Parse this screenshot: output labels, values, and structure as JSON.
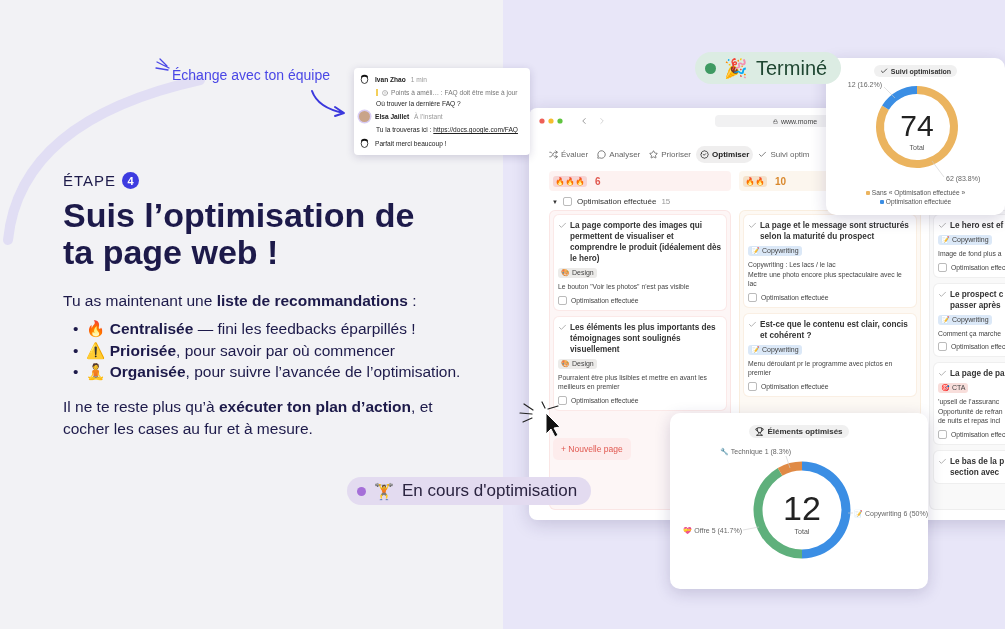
{
  "annotation": {
    "text": "Échange avec ton équipe"
  },
  "chat": {
    "messages": [
      {
        "kind": "sketch",
        "author": "Ivan Zhao",
        "time": "1 min",
        "quote": "Points à améli…  : FAQ doit être mise à jour",
        "text": "Où trouver la dernière FAQ ?"
      },
      {
        "kind": "photo",
        "author": "Elsa Jaillet",
        "time": "À l’instant",
        "text": "Tu la trouveras ici : ",
        "link": "https://docs.google.com/FAQ"
      },
      {
        "kind": "sketch",
        "text": "Parfait merci beaucoup !"
      }
    ]
  },
  "step": {
    "label": "ÉTAPE",
    "number": "4"
  },
  "heading": "**Suis l’optimisation** de ta page web !",
  "intro": "Tu as maintenant une **liste de recommandations** :",
  "bullets": [
    {
      "marker": "•",
      "emoji": "🔥",
      "text": "**Centralisée** — fini les feedbacks éparpillés !"
    },
    {
      "marker": "•",
      "emoji": "⚠️",
      "text": "**Priorisée**, pour savoir par où commencer"
    },
    {
      "marker": "•",
      "emoji": "🧘",
      "text": "**Organisée**, pour suivre l’avancée de l’optimisation."
    }
  ],
  "closing": "Il ne te reste plus qu’à **exécuter ton plan d’action**, et cocher les cases au fur et à mesure.",
  "status_badges": [
    {
      "emoji": "🎉",
      "label": "Terminé",
      "color": "#3f9a62"
    },
    {
      "emoji": "🏋️",
      "label": "En cours d'optimisation",
      "color": "#a56fd8"
    }
  ],
  "app_window": {
    "url": "www.mome",
    "tabs": [
      {
        "label": "Évaluer",
        "selected": false
      },
      {
        "label": "Analyser",
        "selected": false
      },
      {
        "label": "Prioriser",
        "selected": false
      },
      {
        "label": "Optimiser",
        "selected": true
      },
      {
        "label": "Suivi optim",
        "selected": false
      }
    ],
    "group": {
      "caret": "▼",
      "label": "Optimisation effectuée",
      "count": "15",
      "expanded": true,
      "checked": false
    },
    "columns": [
      {
        "flames": "🔥🔥🔥",
        "count": "6",
        "color": "#e0574f",
        "cards": [
          {
            "title": "La page comporte des images qui permettent de visualiser et comprendre le produit (idéalement dès le hero)",
            "tag": {
              "emoji": "🎨",
              "label": "Design",
              "color": "#ecebe9"
            },
            "note": "Le bouton \"Voir les photos\" n'est pas visible",
            "checkbox": {
              "label": "Optimisation effectuée",
              "checked": false
            }
          },
          {
            "title": "Les éléments les plus importants des témoignages sont soulignés visuellement",
            "tag": {
              "emoji": "🎨",
              "label": "Design",
              "color": "#ecebe9"
            },
            "note": "Pourraient être plus lisibles et mettre en avant les meilleurs en premier",
            "checkbox": {
              "label": "Optimisation effectuée",
              "checked": false
            }
          }
        ],
        "add_button": {
          "icon": "+",
          "label": "Nouvelle page"
        }
      },
      {
        "flames": "🔥🔥",
        "count": "10",
        "color": "#d9882c",
        "cards": [
          {
            "title": "La page et le message sont structurés selon la maturité du prospect",
            "tag": {
              "emoji": "📝",
              "label": "Copywriting",
              "color": "#dbe8f7"
            },
            "note": "Copywriting : Les lacs / le lac\nMettre une photo encore plus spectaculaire avec le lac",
            "checkbox": {
              "label": "Optimisation effectuée",
              "checked": false
            }
          },
          {
            "title": "Est-ce que le contenu est clair, concis et cohérent ?",
            "tag": {
              "emoji": "📝",
              "label": "Copywriting",
              "color": "#dbe8f7"
            },
            "note": "Menu déroulant pr le programme avec pictos en premier",
            "checkbox": {
              "label": "Optimisation effectuée",
              "checked": false
            }
          }
        ]
      },
      {
        "cards": [
          {
            "title": "Le hero est ef",
            "tag": {
              "emoji": "📝",
              "label": "Copywriting",
              "color": "#dbe8f7"
            },
            "note": "Image de fond plus a",
            "checkbox": {
              "label": "Optimisation effec",
              "checked": false
            }
          },
          {
            "title": "Le prospect c\npasser après",
            "tag": {
              "emoji": "📝",
              "label": "Copywriting",
              "color": "#dbe8f7"
            },
            "note": "Comment ça marche",
            "checkbox": {
              "label": "Optimisation effec",
              "checked": false
            }
          },
          {
            "title": "La page de pa",
            "tag": {
              "emoji": "🎯",
              "label": "CTA",
              "color": "#f8dedb"
            },
            "note": "’upsell de l’assuranc\nOpportunité de refran\nde nuits et repas incl",
            "checkbox": {
              "label": "Optimisation effec",
              "checked": false
            }
          },
          {
            "title": "Le bas de la p\nsection avec"
          }
        ]
      }
    ]
  },
  "charts": [
    {
      "chart_data": {
        "type": "donut",
        "title": "Suivi optimisation",
        "categories": [
          "Sans « Optimisation effectuée »",
          "Optimisation effectuée"
        ],
        "values": [
          62,
          12
        ],
        "value_labels": [
          "62 (83.8%)",
          "12 (16.2%)"
        ]
      },
      "slice_styles": [
        {
          "color": "#ebb45f"
        },
        {
          "color": "#3b8ee4"
        }
      ],
      "center_value": "74",
      "center_label": "Total",
      "legend": true
    },
    {
      "chart_data": {
        "type": "donut",
        "title": "Éléments optimisés",
        "categories": [
          "Copywriting",
          "Offre",
          "Technique"
        ],
        "values": [
          50,
          41.7,
          8.3
        ],
        "value_labels": [
          "6 (50%)",
          "5 (41.7%)",
          "1 (8.3%)"
        ]
      },
      "slice_styles": [
        {
          "color": "#3b8ee4"
        },
        {
          "color": "#5fb07c"
        },
        {
          "color": "#e08a45"
        }
      ],
      "slice_icons": [
        "📝",
        "💝",
        "🔧"
      ],
      "center_value": "12",
      "center_label": "Total",
      "legend": false
    }
  ]
}
